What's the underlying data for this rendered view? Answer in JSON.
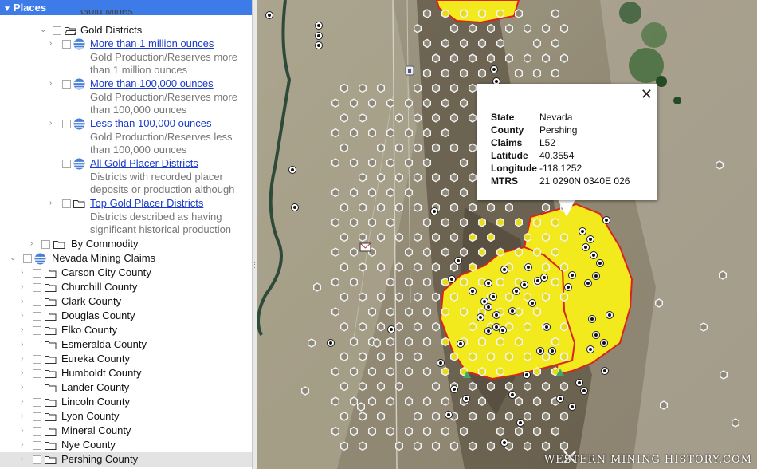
{
  "panel": {
    "title": "Places",
    "clipped_item": "Gold Mines",
    "gold_districts": "Gold Districts",
    "districts": [
      {
        "label": "More than 1 million ounces",
        "desc1": "Gold Production/Reserves more",
        "desc2": "than 1 million ounces"
      },
      {
        "label": "More than 100,000 ounces",
        "desc1": "Gold Production/Reserves more",
        "desc2": "than 100,000 ounces"
      },
      {
        "label": "Less than 100,000 ounces",
        "desc1": "Gold Production/Reserves less",
        "desc2": "than 100,000 ounces"
      },
      {
        "label": "All Gold Placer Districts",
        "desc1": "Districts with recorded placer",
        "desc2": "deposits or production although"
      },
      {
        "label": "Top Gold Placer Districts",
        "desc1": "Districts described as having",
        "desc2": "significant historical production"
      }
    ],
    "by_commodity": "By Commodity",
    "nevada_claims": "Nevada Mining Claims",
    "counties": [
      "Carson City County",
      "Churchill County",
      "Clark County",
      "Douglas County",
      "Elko County",
      "Esmeralda County",
      "Eureka County",
      "Humboldt County",
      "Lander County",
      "Lincoln County",
      "Lyon County",
      "Mineral County",
      "Nye County",
      "Pershing County"
    ]
  },
  "popup": {
    "close": "✕",
    "rows": [
      {
        "key": "State",
        "value": "Nevada"
      },
      {
        "key": "County",
        "value": "Pershing"
      },
      {
        "key": "Claims",
        "value": "L52"
      },
      {
        "key": "Latitude",
        "value": "40.3554"
      },
      {
        "key": "Longitude",
        "value": "-118.1252"
      },
      {
        "key": "MTRS",
        "value": "21 0290N 0340E 026"
      }
    ]
  },
  "watermark": "WESTERN MINING HISTORY.COM",
  "colors": {
    "accent": "#3d7ce8",
    "link": "#1a3cc8",
    "district_fill": "#f2ea1c",
    "district_border": "#d8241c"
  }
}
